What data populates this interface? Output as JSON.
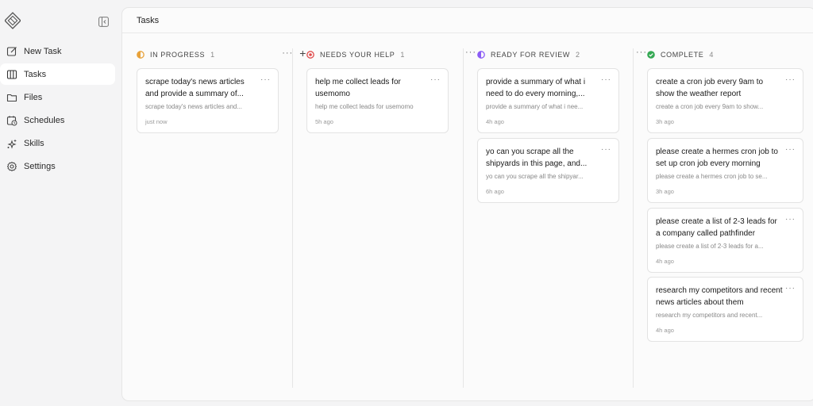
{
  "sidebar": {
    "items": [
      {
        "label": "New Task",
        "icon": "edit-icon"
      },
      {
        "label": "Tasks",
        "icon": "columns-icon"
      },
      {
        "label": "Files",
        "icon": "folder-icon"
      },
      {
        "label": "Schedules",
        "icon": "calendar-clock-icon"
      },
      {
        "label": "Skills",
        "icon": "sparkles-icon"
      },
      {
        "label": "Settings",
        "icon": "gear-icon"
      }
    ],
    "active": "Tasks"
  },
  "header": {
    "title": "Tasks"
  },
  "colors": {
    "in_progress": "#e8a23a",
    "needs_help": "#e04a4a",
    "ready_for_review": "#8b5cf6",
    "complete": "#34a853"
  },
  "columns": [
    {
      "title": "IN PROGRESS",
      "count": "1",
      "cards": [
        {
          "title": "scrape today's news articles and provide a summary of...",
          "subtitle": "scrape today's news articles and...",
          "time": "just now"
        }
      ]
    },
    {
      "title": "NEEDS YOUR HELP",
      "count": "1",
      "cards": [
        {
          "title": "help me collect leads for usemomo",
          "subtitle": "help me collect leads for usemomo",
          "time": "5h ago"
        }
      ]
    },
    {
      "title": "READY FOR REVIEW",
      "count": "2",
      "cards": [
        {
          "title": "provide a summary of what i need to do every morning,...",
          "subtitle": "provide a summary of what i nee...",
          "time": "4h ago"
        },
        {
          "title": "yo can you scrape all the shipyards in this page, and...",
          "subtitle": "yo can you scrape all the shipyar...",
          "time": "6h ago"
        }
      ]
    },
    {
      "title": "COMPLETE",
      "count": "4",
      "cards": [
        {
          "title": "create a cron job every 9am to show the weather report",
          "subtitle": "create a cron job every 9am to show...",
          "time": "3h ago"
        },
        {
          "title": "please create a hermes cron job to set up cron job every morning",
          "subtitle": "please create a hermes cron job to se...",
          "time": "3h ago"
        },
        {
          "title": "please create a list of 2-3 leads for a company called pathfinder",
          "subtitle": "please create a list of 2-3 leads for a...",
          "time": "4h ago"
        },
        {
          "title": "research my competitors and recent news articles about them",
          "subtitle": "research my competitors and recent...",
          "time": "4h ago"
        }
      ]
    }
  ]
}
